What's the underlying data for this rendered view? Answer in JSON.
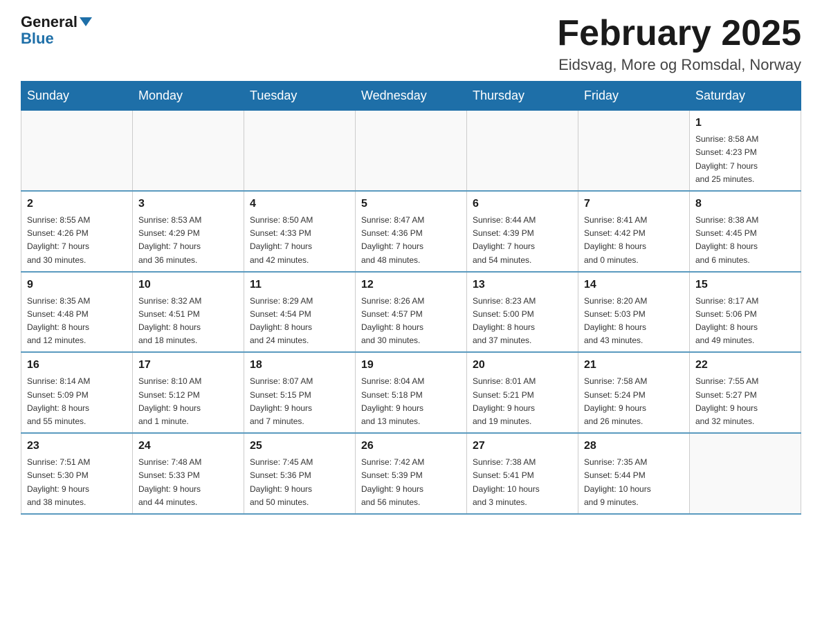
{
  "header": {
    "logo_general": "General",
    "logo_blue": "Blue",
    "month_title": "February 2025",
    "location": "Eidsvag, More og Romsdal, Norway"
  },
  "calendar": {
    "days_of_week": [
      "Sunday",
      "Monday",
      "Tuesday",
      "Wednesday",
      "Thursday",
      "Friday",
      "Saturday"
    ],
    "weeks": [
      [
        {
          "day": "",
          "info": ""
        },
        {
          "day": "",
          "info": ""
        },
        {
          "day": "",
          "info": ""
        },
        {
          "day": "",
          "info": ""
        },
        {
          "day": "",
          "info": ""
        },
        {
          "day": "",
          "info": ""
        },
        {
          "day": "1",
          "info": "Sunrise: 8:58 AM\nSunset: 4:23 PM\nDaylight: 7 hours\nand 25 minutes."
        }
      ],
      [
        {
          "day": "2",
          "info": "Sunrise: 8:55 AM\nSunset: 4:26 PM\nDaylight: 7 hours\nand 30 minutes."
        },
        {
          "day": "3",
          "info": "Sunrise: 8:53 AM\nSunset: 4:29 PM\nDaylight: 7 hours\nand 36 minutes."
        },
        {
          "day": "4",
          "info": "Sunrise: 8:50 AM\nSunset: 4:33 PM\nDaylight: 7 hours\nand 42 minutes."
        },
        {
          "day": "5",
          "info": "Sunrise: 8:47 AM\nSunset: 4:36 PM\nDaylight: 7 hours\nand 48 minutes."
        },
        {
          "day": "6",
          "info": "Sunrise: 8:44 AM\nSunset: 4:39 PM\nDaylight: 7 hours\nand 54 minutes."
        },
        {
          "day": "7",
          "info": "Sunrise: 8:41 AM\nSunset: 4:42 PM\nDaylight: 8 hours\nand 0 minutes."
        },
        {
          "day": "8",
          "info": "Sunrise: 8:38 AM\nSunset: 4:45 PM\nDaylight: 8 hours\nand 6 minutes."
        }
      ],
      [
        {
          "day": "9",
          "info": "Sunrise: 8:35 AM\nSunset: 4:48 PM\nDaylight: 8 hours\nand 12 minutes."
        },
        {
          "day": "10",
          "info": "Sunrise: 8:32 AM\nSunset: 4:51 PM\nDaylight: 8 hours\nand 18 minutes."
        },
        {
          "day": "11",
          "info": "Sunrise: 8:29 AM\nSunset: 4:54 PM\nDaylight: 8 hours\nand 24 minutes."
        },
        {
          "day": "12",
          "info": "Sunrise: 8:26 AM\nSunset: 4:57 PM\nDaylight: 8 hours\nand 30 minutes."
        },
        {
          "day": "13",
          "info": "Sunrise: 8:23 AM\nSunset: 5:00 PM\nDaylight: 8 hours\nand 37 minutes."
        },
        {
          "day": "14",
          "info": "Sunrise: 8:20 AM\nSunset: 5:03 PM\nDaylight: 8 hours\nand 43 minutes."
        },
        {
          "day": "15",
          "info": "Sunrise: 8:17 AM\nSunset: 5:06 PM\nDaylight: 8 hours\nand 49 minutes."
        }
      ],
      [
        {
          "day": "16",
          "info": "Sunrise: 8:14 AM\nSunset: 5:09 PM\nDaylight: 8 hours\nand 55 minutes."
        },
        {
          "day": "17",
          "info": "Sunrise: 8:10 AM\nSunset: 5:12 PM\nDaylight: 9 hours\nand 1 minute."
        },
        {
          "day": "18",
          "info": "Sunrise: 8:07 AM\nSunset: 5:15 PM\nDaylight: 9 hours\nand 7 minutes."
        },
        {
          "day": "19",
          "info": "Sunrise: 8:04 AM\nSunset: 5:18 PM\nDaylight: 9 hours\nand 13 minutes."
        },
        {
          "day": "20",
          "info": "Sunrise: 8:01 AM\nSunset: 5:21 PM\nDaylight: 9 hours\nand 19 minutes."
        },
        {
          "day": "21",
          "info": "Sunrise: 7:58 AM\nSunset: 5:24 PM\nDaylight: 9 hours\nand 26 minutes."
        },
        {
          "day": "22",
          "info": "Sunrise: 7:55 AM\nSunset: 5:27 PM\nDaylight: 9 hours\nand 32 minutes."
        }
      ],
      [
        {
          "day": "23",
          "info": "Sunrise: 7:51 AM\nSunset: 5:30 PM\nDaylight: 9 hours\nand 38 minutes."
        },
        {
          "day": "24",
          "info": "Sunrise: 7:48 AM\nSunset: 5:33 PM\nDaylight: 9 hours\nand 44 minutes."
        },
        {
          "day": "25",
          "info": "Sunrise: 7:45 AM\nSunset: 5:36 PM\nDaylight: 9 hours\nand 50 minutes."
        },
        {
          "day": "26",
          "info": "Sunrise: 7:42 AM\nSunset: 5:39 PM\nDaylight: 9 hours\nand 56 minutes."
        },
        {
          "day": "27",
          "info": "Sunrise: 7:38 AM\nSunset: 5:41 PM\nDaylight: 10 hours\nand 3 minutes."
        },
        {
          "day": "28",
          "info": "Sunrise: 7:35 AM\nSunset: 5:44 PM\nDaylight: 10 hours\nand 9 minutes."
        },
        {
          "day": "",
          "info": ""
        }
      ]
    ]
  }
}
